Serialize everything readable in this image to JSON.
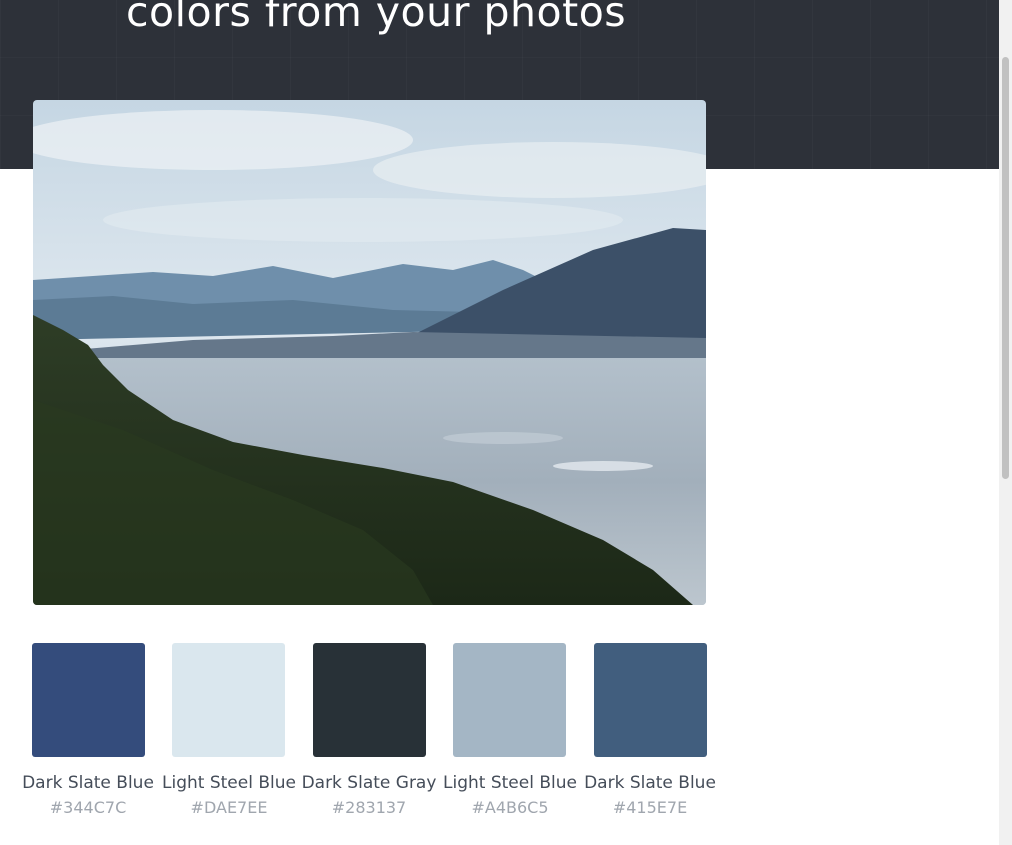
{
  "hero": {
    "title": "colors from your photos"
  },
  "photo": {
    "alt": ""
  },
  "palette": [
    {
      "name": "Dark Slate Blue",
      "hex": "#344C7C"
    },
    {
      "name": "Light Steel Blue",
      "hex": "#DAE7EE"
    },
    {
      "name": "Dark Slate Gray",
      "hex": "#283137"
    },
    {
      "name": "Light Steel Blue",
      "hex": "#A4B6C5"
    },
    {
      "name": "Dark Slate Blue",
      "hex": "#415E7E"
    }
  ]
}
